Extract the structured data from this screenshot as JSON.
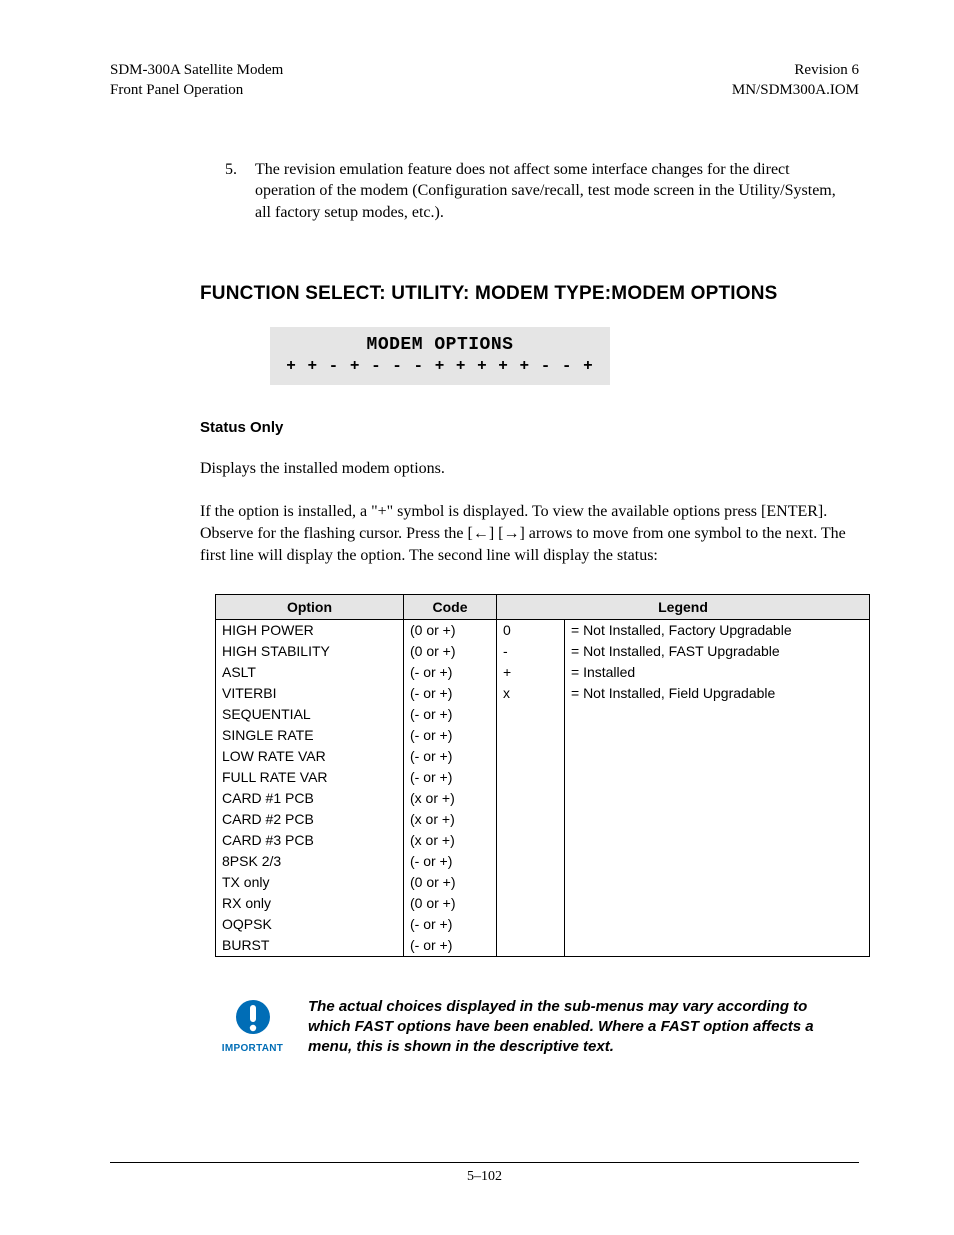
{
  "header": {
    "left_line1": "SDM-300A Satellite Modem",
    "left_line2": "Front Panel Operation",
    "right_line1": "Revision 6",
    "right_line2": "MN/SDM300A.IOM"
  },
  "list_item": {
    "number": "5.",
    "text": "The revision emulation feature does not affect some interface changes for the direct operation of the modem (Configuration save/recall, test mode screen in the Utility/System, all factory setup modes, etc.)."
  },
  "section_title": "FUNCTION SELECT: UTILITY: MODEM TYPE:MODEM OPTIONS",
  "lcd": {
    "line1": "MODEM OPTIONS",
    "line2": "+ + - + - - - + + + + + - - +"
  },
  "status_only_label": "Status Only",
  "para1": "Displays the installed modem options.",
  "para2": "If the option is installed, a \"+\" symbol is displayed. To view the available options press [ENTER]. Observe for the flashing cursor. Press the [←] [→] arrows to move from one symbol to the next. The first line will display the option. The second line will display the status:",
  "table": {
    "headers": {
      "option": "Option",
      "code": "Code",
      "legend": "Legend"
    },
    "rows": [
      {
        "option": "HIGH POWER",
        "code": "(0 or  +)"
      },
      {
        "option": "HIGH STABILITY",
        "code": "(0 or  +)"
      },
      {
        "option": "ASLT",
        "code": "(- or +)"
      },
      {
        "option": "VITERBI",
        "code": "(- or +)"
      },
      {
        "option": "SEQUENTIAL",
        "code": "(- or +)"
      },
      {
        "option": "SINGLE RATE",
        "code": "(- or +)"
      },
      {
        "option": "LOW RATE VAR",
        "code": "(- or +)"
      },
      {
        "option": "FULL RATE VAR",
        "code": "(- or +)"
      },
      {
        "option": "CARD #1 PCB",
        "code": "(x or +)"
      },
      {
        "option": "CARD #2 PCB",
        "code": "(x or +)"
      },
      {
        "option": "CARD #3 PCB",
        "code": "(x or +)"
      },
      {
        "option": "8PSK 2/3",
        "code": "(- or +)"
      },
      {
        "option": "TX only",
        "code": "(0 or +)"
      },
      {
        "option": "RX only",
        "code": "(0 or +)"
      },
      {
        "option": "OQPSK",
        "code": "(- or +)"
      },
      {
        "option": "BURST",
        "code": "(- or +)"
      }
    ],
    "legend": [
      {
        "sym": "0",
        "text": "= Not Installed, Factory Upgradable"
      },
      {
        "sym": "-",
        "text": "= Not Installed, FAST Upgradable"
      },
      {
        "sym": "+",
        "text": "= Installed"
      },
      {
        "sym": "x",
        "text": "= Not Installed, Field Upgradable"
      }
    ]
  },
  "important": {
    "label": "IMPORTANT",
    "text": "The actual choices displayed in the sub-menus may vary according to which FAST options have been enabled. Where a FAST option affects a menu, this is shown in the descriptive text."
  },
  "footer": "5–102"
}
